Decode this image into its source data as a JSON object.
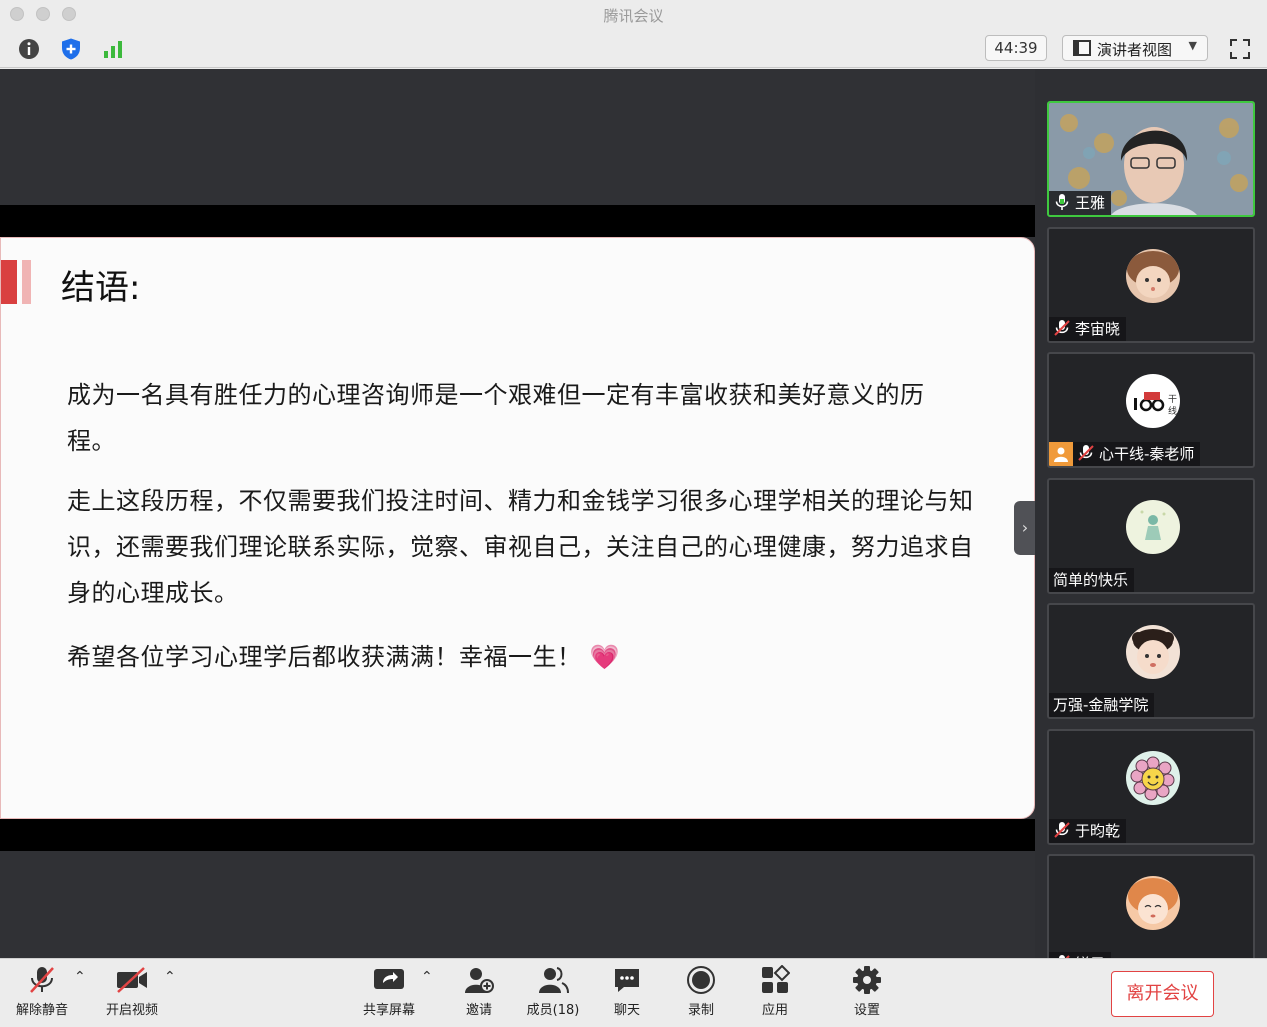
{
  "window": {
    "title": "腾讯会议"
  },
  "toolbar": {
    "info_icon": "info-icon",
    "security_icon": "shield-icon",
    "signal_icon": "signal-icon",
    "timer": "44:39",
    "view_mode": "演讲者视图",
    "fullscreen_icon": "fullscreen-icon"
  },
  "slide": {
    "title": "结语:",
    "paragraphs": [
      "成为一名具有胜任力的心理咨询师是一个艰难但一定有丰富收获和美好意义的历程。",
      "走上这段历程，不仅需要我们投注时间、精力和金钱学习很多心理学相关的理论与知识，还需要我们理论联系实际，觉察、审视自己，关注自己的心理健康，努力追求自身的心理成长。",
      "希望各位学习心理学后都收获满满！幸福一生！"
    ],
    "emoji": "💗"
  },
  "participants": [
    {
      "name": "王雅",
      "mic": "on",
      "active_speaker": true
    },
    {
      "name": "李宙晓",
      "mic": "muted"
    },
    {
      "name": "心干线-秦老师",
      "mic": "muted",
      "host_badge": true
    },
    {
      "name": "简单的快乐",
      "mic": "none"
    },
    {
      "name": "万强-金融学院",
      "mic": "none"
    },
    {
      "name": "于昀乾",
      "mic": "muted"
    },
    {
      "name": "镁子",
      "mic": "muted"
    }
  ],
  "bottom": {
    "unmute": "解除静音",
    "start_video": "开启视频",
    "share_screen": "共享屏幕",
    "invite": "邀请",
    "members": "成员(18)",
    "chat": "聊天",
    "record": "录制",
    "apps": "应用",
    "settings": "设置",
    "leave": "离开会议"
  },
  "colors": {
    "accent_red": "#e24343",
    "active_green": "#3fc93f"
  }
}
